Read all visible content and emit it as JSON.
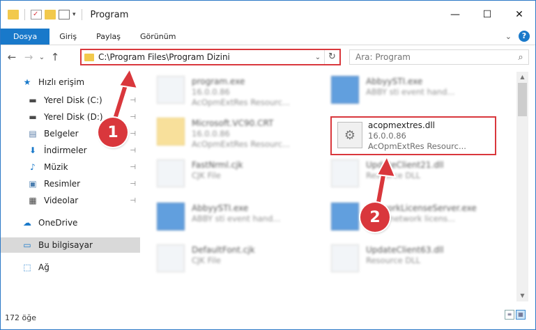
{
  "window": {
    "title": "Program",
    "controls": {
      "minimize": "—",
      "maximize": "☐",
      "close": "✕"
    }
  },
  "ribbon": {
    "tabs": [
      {
        "label": "Dosya",
        "active": true
      },
      {
        "label": "Giriş"
      },
      {
        "label": "Paylaş"
      },
      {
        "label": "Görünüm"
      }
    ],
    "expand": "⌄",
    "help": "?"
  },
  "nav": {
    "back": "←",
    "forward": "→",
    "history": "⌄",
    "up": "↑",
    "address": "C:\\Program Files\\Program Dizini",
    "address_dropdown": "⌄",
    "refresh": "↻",
    "search_placeholder": "Ara: Program",
    "search_icon": "⌕"
  },
  "sidebar": {
    "items": [
      {
        "label": "Hızlı erişim",
        "icon": "star-icon",
        "glyph": "★",
        "color": "#1979ca"
      },
      {
        "label": "Yerel Disk (C:)",
        "icon": "disk-icon",
        "glyph": "▬",
        "color": "#4a4a4a",
        "pinned": true
      },
      {
        "label": "Yerel Disk (D:)",
        "icon": "disk-icon",
        "glyph": "▬",
        "color": "#4a4a4a",
        "pinned": true
      },
      {
        "label": "Belgeler",
        "icon": "document-icon",
        "glyph": "▤",
        "color": "#5a7ea8",
        "pinned": true
      },
      {
        "label": "İndirmeler",
        "icon": "download-icon",
        "glyph": "⬇",
        "color": "#1979ca",
        "pinned": true
      },
      {
        "label": "Müzik",
        "icon": "music-icon",
        "glyph": "♪",
        "color": "#1979ca",
        "pinned": true
      },
      {
        "label": "Resimler",
        "icon": "pictures-icon",
        "glyph": "▣",
        "color": "#4c7fb0",
        "pinned": true
      },
      {
        "label": "Videolar",
        "icon": "video-icon",
        "glyph": "▦",
        "color": "#444",
        "pinned": true
      },
      {
        "label": "OneDrive",
        "icon": "cloud-icon",
        "glyph": "☁",
        "color": "#1979ca"
      },
      {
        "label": "Bu bilgisayar",
        "icon": "computer-icon",
        "glyph": "▭",
        "color": "#1979ca",
        "selected": true
      },
      {
        "label": "Ağ",
        "icon": "network-icon",
        "glyph": "⬚",
        "color": "#1979ca"
      }
    ],
    "pin_glyph": "📌"
  },
  "files": [
    {
      "name": "program.exe",
      "sub1": "16.0.0.86",
      "sub2": "AcOpmExtRes Resourc...",
      "kind": "exe-generic"
    },
    {
      "name": "AbbyySTI.exe",
      "sub1": "ABBY sti event hand...",
      "sub2": "",
      "kind": "exe"
    },
    {
      "name": "Microsoft.VC90.CRT",
      "sub1": "16.0.0.86",
      "sub2": "AcOpmExtRes Resourc...",
      "kind": "folder"
    },
    {
      "name": "FastNrml.cjk",
      "sub1": "CJK File",
      "sub2": "",
      "kind": "file"
    },
    {
      "name": "UpdateClient21.dll",
      "sub1": "Resource DLL",
      "sub2": "",
      "kind": "dll"
    },
    {
      "name": "AbbyySTI.exe",
      "sub1": "ABBY sti event hand...",
      "sub2": "",
      "kind": "exe"
    },
    {
      "name": "NetworkLicenseServer.exe",
      "sub1": "ABBY network licens...",
      "sub2": "",
      "kind": "exe"
    },
    {
      "name": "DefaultFont.cjk",
      "sub1": "CJK File",
      "sub2": "",
      "kind": "file"
    },
    {
      "name": "UpdateClient63.dll",
      "sub1": "Resource DLL",
      "sub2": "",
      "kind": "dll"
    }
  ],
  "highlight": {
    "name": "acopmextres.dll",
    "version": "16.0.0.86",
    "description": "AcOpmExtRes Resourc...",
    "icon_glyph": "⚙"
  },
  "badges": {
    "one": "1",
    "two": "2"
  },
  "status": {
    "count": "172 öğe"
  },
  "colors": {
    "accent": "#1979ca",
    "highlight": "#d9373c"
  }
}
